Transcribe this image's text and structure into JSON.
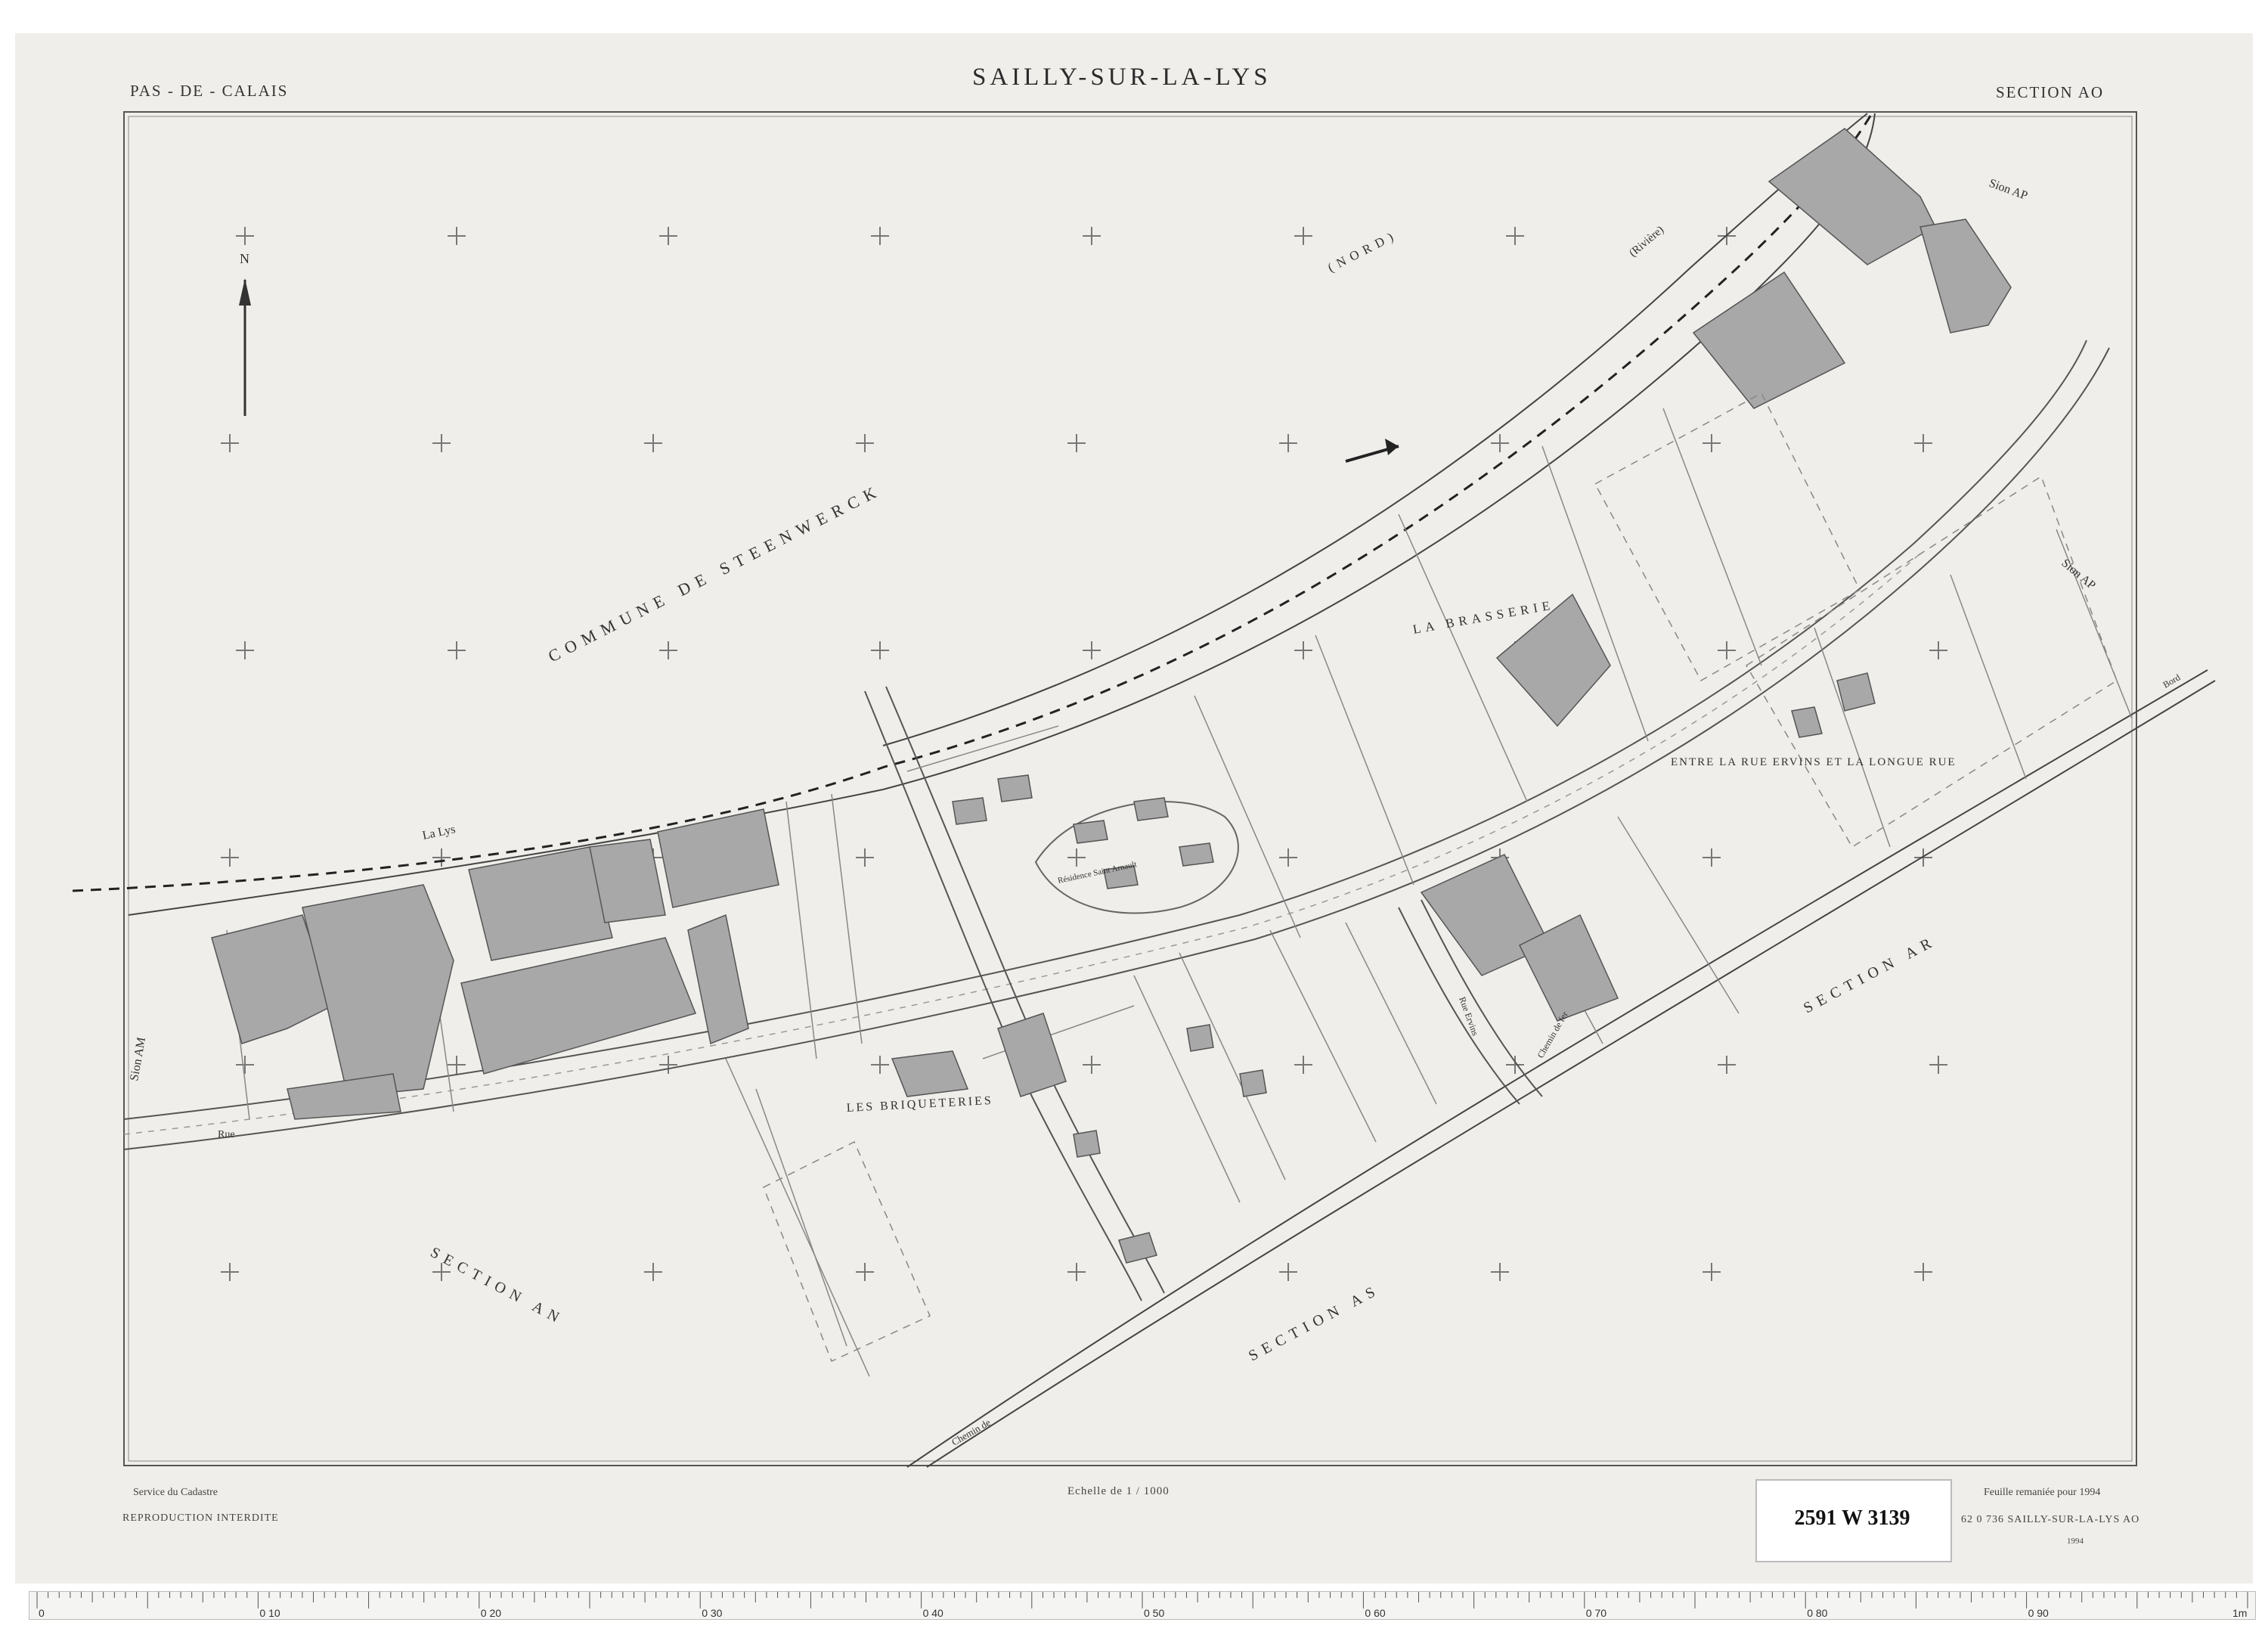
{
  "header": {
    "department": "PAS - DE - CALAIS",
    "commune": "SAILLY-SUR-LA-LYS",
    "section": "SECTION AO"
  },
  "footer": {
    "service": "Service du Cadastre",
    "reproduction": "REPRODUCTION INTERDITE",
    "scale": "Echelle de 1 / 1000",
    "remaniee": "Feuille remaniée pour 1994",
    "code_line": "62 0 736 SAILLY-SUR-LA-LYS AO",
    "year": "1994"
  },
  "archive_label": "2591 W 3139",
  "map_labels": {
    "commune_de": "COMMUNE DE STEENWERCK",
    "nord": "(NORD)",
    "la_lys": "La Lys",
    "riviere": "(Rivière)",
    "la_brasserie": "LA BRASSERIE",
    "entre": "ENTRE LA RUE ERVINS ET LA LONGUE RUE",
    "les_briqueteries": "LES BRIQUETERIES",
    "residence": "Résidence Saint Arnault",
    "section_an": "SECTION AN",
    "section_as": "SECTION AS",
    "section_ar": "SECTION AR",
    "section_ap_top": "Sion AP",
    "section_ap_mid": "Sion AP",
    "section_am": "Sion AM",
    "rue": "Rue",
    "chemin": "Chemin de",
    "chemin_fer": "Chemin de fer",
    "north": "N",
    "rue_ervins": "Rue Ervins",
    "bord": "Bord"
  },
  "ruler": {
    "marks": [
      "0",
      "0 10",
      "0 20",
      "0 30",
      "0 40",
      "0 50",
      "0 60",
      "0 70",
      "0 80",
      "0 90",
      "1m"
    ]
  },
  "colors": {
    "paper": "#efeeea",
    "line": "#555555",
    "building": "#a9a9a9",
    "river": "#333333"
  }
}
